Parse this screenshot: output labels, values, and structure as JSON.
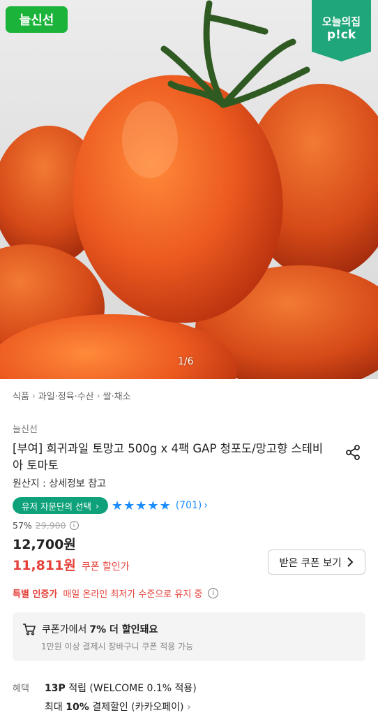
{
  "hero": {
    "badge": "늘신선",
    "pick_line1": "오늘의집",
    "pick_line2": "p!ck",
    "counter": "1/6",
    "colors": {
      "badge": "#1cb33a",
      "pick": "#1fa67a",
      "tomato": "#e8501f"
    }
  },
  "breadcrumb": [
    "식품",
    "과일·정육·수산",
    "쌀·채소"
  ],
  "product": {
    "brand": "늘신선",
    "title": "[부여] 희귀과일 토망고 500g x 4팩 GAP 청포도/망고향 스테비아 토마토",
    "origin": "원산지 : 상세정보 참고",
    "user_pick_label": "유저 자문단의 선택",
    "rating": 5,
    "review_count": "(701)",
    "discount_rate": "57%",
    "original_price": "29,900",
    "price": "12,700원",
    "coupon_price": "11,811원",
    "coupon_price_label": "쿠폰 할인가",
    "coupon_button": "받은 쿠폰 보기"
  },
  "certification": {
    "label": "특별 인증가",
    "text": "매일 온라인 최저가 수준으로 유지 중"
  },
  "coupon_box": {
    "prefix": "쿠폰가에서",
    "highlight": "7% 더 할인돼요",
    "sub": "1만원 이상 결제시 장바구니 쿠폰 적용 가능"
  },
  "benefits": {
    "label": "혜택",
    "line1_bold": "13P",
    "line1_rest": "적립 (WELCOME 0.1% 적용)",
    "line2_prefix": "최대",
    "line2_bold": "10%",
    "line2_rest": "결제할인 (카카오페이)"
  },
  "accent": {
    "red": "#e5413a",
    "blue": "#1a8cff",
    "green": "#0fa27a"
  }
}
